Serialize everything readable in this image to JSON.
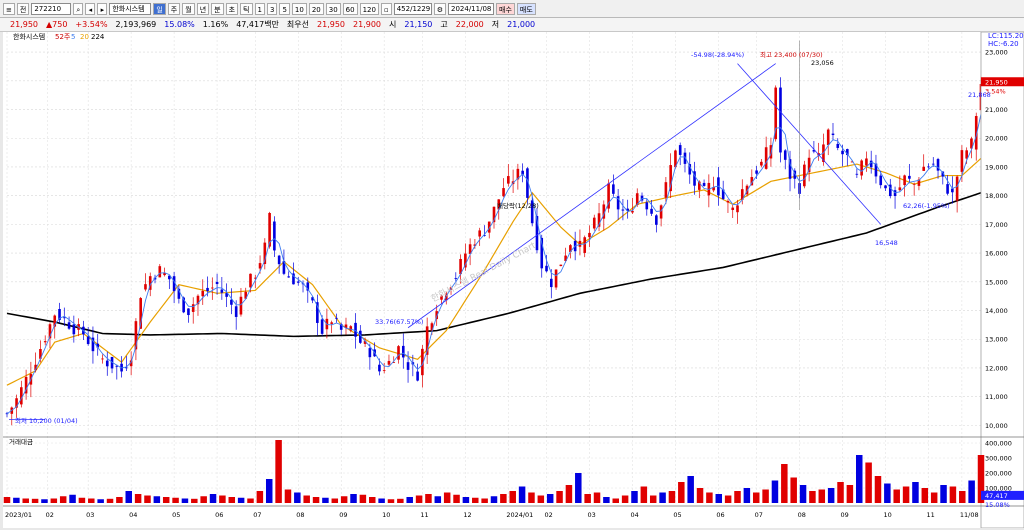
{
  "toolbar": {
    "menu_icon": "menu-icon",
    "market_label": "전",
    "code": "272210",
    "stock_name": "한화시스템",
    "periods": [
      "주",
      "월",
      "년",
      "분",
      "초",
      "틱"
    ],
    "intervals": [
      "1",
      "3",
      "5",
      "10",
      "20",
      "30",
      "60",
      "120"
    ],
    "page_counter": "452/1229",
    "date": "2024/11/08",
    "buy_label": "매수",
    "sell_label": "매도"
  },
  "quote": {
    "price": "21,950",
    "change": "▲750",
    "change_pct": "+3.54%",
    "volume": "2,193,969",
    "turnover_pct": "15.08%",
    "ratio": "1.16%",
    "amount": "47,417백만",
    "extra_label": "최우선",
    "bid": "21,950",
    "ask": "21,900",
    "open_label": "시",
    "open": "21,150",
    "high_label": "고",
    "high": "22,000",
    "low_label": "저",
    "low": "21,000"
  },
  "legend": {
    "name": "한화시스템",
    "ma_label": "52주",
    "ma5": "5",
    "ma20": "20",
    "ma224": "224"
  },
  "volume_legend": "거래대금",
  "annotations": {
    "lc": "LC:115.20",
    "hc": "HC:-6.20",
    "high_note": "최고 23,400 (07/30)",
    "low_note": "최저 10,200 (01/04)",
    "trend_note_down": "-54.98(-28.94%)",
    "trend_note_up": "33.76(67.57%)",
    "peak_label": "23,056",
    "trough_label": "16,548",
    "right_label": "21,868",
    "dividend_label": "배당락(12/28)",
    "vol_ma_label": "62,26(-1.95%)",
    "watermark": "한화시스템  Real Daily Chart"
  },
  "colors": {
    "up": "#e00000",
    "down": "#0000e0",
    "ma5": "#3d7df0",
    "ma20": "#e8a000",
    "ma224": "#000000",
    "trend": "#3030ff"
  },
  "chart_data": {
    "type": "candlestick",
    "price_axis": [
      "23,000",
      "22,000",
      "21,000",
      "20,000",
      "19,000",
      "18,000",
      "17,000",
      "16,000",
      "15,000",
      "14,000",
      "13,000",
      "12,000",
      "11,000",
      "10,000"
    ],
    "price_range": [
      9700,
      23700
    ],
    "current_price": "21,950",
    "current_pct": "3.54%",
    "volume_axis": [
      "400,000",
      "300,000",
      "200,000",
      "100,000"
    ],
    "volume_range": [
      0,
      420000
    ],
    "current_volume": "47,417",
    "current_volume_pct": "15.08%",
    "x_ticks": [
      "2023/01",
      "02",
      "03",
      "04",
      "05",
      "06",
      "07",
      "08",
      "09",
      "10",
      "11",
      "12",
      "2024/01",
      "02",
      "03",
      "04",
      "05",
      "06",
      "07",
      "08",
      "09",
      "10",
      "11",
      "11/08"
    ],
    "close_path": [
      [
        0,
        10400
      ],
      [
        2,
        10900
      ],
      [
        4,
        11600
      ],
      [
        6,
        12300
      ],
      [
        8,
        13100
      ],
      [
        10,
        13900
      ],
      [
        12,
        13700
      ],
      [
        14,
        13400
      ],
      [
        16,
        13200
      ],
      [
        18,
        12700
      ],
      [
        20,
        12300
      ],
      [
        22,
        12100
      ],
      [
        24,
        11900
      ],
      [
        26,
        12500
      ],
      [
        28,
        14600
      ],
      [
        30,
        15200
      ],
      [
        32,
        15400
      ],
      [
        34,
        15100
      ],
      [
        36,
        14300
      ],
      [
        38,
        14000
      ],
      [
        40,
        14500
      ],
      [
        42,
        14700
      ],
      [
        44,
        14900
      ],
      [
        46,
        14400
      ],
      [
        48,
        14000
      ],
      [
        50,
        14800
      ],
      [
        52,
        15300
      ],
      [
        54,
        16200
      ],
      [
        55,
        17200
      ],
      [
        56,
        16100
      ],
      [
        58,
        15300
      ],
      [
        60,
        15100
      ],
      [
        62,
        14800
      ],
      [
        64,
        14200
      ],
      [
        66,
        13300
      ],
      [
        68,
        13700
      ],
      [
        70,
        13300
      ],
      [
        72,
        13400
      ],
      [
        74,
        12900
      ],
      [
        76,
        12600
      ],
      [
        78,
        11900
      ],
      [
        80,
        12200
      ],
      [
        82,
        12700
      ],
      [
        84,
        12100
      ],
      [
        86,
        11800
      ],
      [
        88,
        13400
      ],
      [
        90,
        14200
      ],
      [
        92,
        14800
      ],
      [
        94,
        15200
      ],
      [
        96,
        16000
      ],
      [
        98,
        16500
      ],
      [
        100,
        16800
      ],
      [
        102,
        17500
      ],
      [
        104,
        18300
      ],
      [
        106,
        18600
      ],
      [
        108,
        18900
      ],
      [
        110,
        17100
      ],
      [
        112,
        15600
      ],
      [
        114,
        15000
      ],
      [
        116,
        15700
      ],
      [
        118,
        16400
      ],
      [
        120,
        16200
      ],
      [
        122,
        16700
      ],
      [
        124,
        17300
      ],
      [
        126,
        18200
      ],
      [
        128,
        17600
      ],
      [
        130,
        17300
      ],
      [
        132,
        18100
      ],
      [
        134,
        17700
      ],
      [
        136,
        17200
      ],
      [
        138,
        18300
      ],
      [
        140,
        19700
      ],
      [
        142,
        19000
      ],
      [
        144,
        18400
      ],
      [
        146,
        18100
      ],
      [
        148,
        18500
      ],
      [
        150,
        17900
      ],
      [
        152,
        17500
      ],
      [
        154,
        18200
      ],
      [
        156,
        18700
      ],
      [
        158,
        19100
      ],
      [
        160,
        19800
      ],
      [
        161,
        21800
      ],
      [
        162,
        19500
      ],
      [
        164,
        18700
      ],
      [
        166,
        18300
      ],
      [
        168,
        19500
      ],
      [
        170,
        19300
      ],
      [
        172,
        20200
      ],
      [
        174,
        19600
      ],
      [
        176,
        19300
      ],
      [
        178,
        18600
      ],
      [
        180,
        19400
      ],
      [
        182,
        18800
      ],
      [
        184,
        18200
      ],
      [
        186,
        18000
      ],
      [
        188,
        18600
      ],
      [
        190,
        18400
      ],
      [
        192,
        19000
      ],
      [
        194,
        19100
      ],
      [
        196,
        18500
      ],
      [
        198,
        18000
      ],
      [
        200,
        19400
      ],
      [
        202,
        19800
      ],
      [
        204,
        21900
      ]
    ],
    "ma20_path": [
      [
        0,
        11400
      ],
      [
        6,
        11900
      ],
      [
        10,
        12900
      ],
      [
        16,
        13200
      ],
      [
        24,
        12200
      ],
      [
        30,
        13600
      ],
      [
        36,
        14900
      ],
      [
        44,
        14600
      ],
      [
        52,
        14700
      ],
      [
        58,
        15700
      ],
      [
        64,
        14900
      ],
      [
        70,
        13500
      ],
      [
        78,
        12700
      ],
      [
        86,
        12300
      ],
      [
        92,
        13300
      ],
      [
        100,
        15400
      ],
      [
        106,
        17100
      ],
      [
        110,
        18100
      ],
      [
        116,
        16900
      ],
      [
        120,
        16300
      ],
      [
        126,
        16900
      ],
      [
        132,
        17700
      ],
      [
        140,
        18000
      ],
      [
        146,
        18200
      ],
      [
        152,
        17700
      ],
      [
        156,
        18100
      ],
      [
        160,
        18500
      ],
      [
        166,
        18700
      ],
      [
        172,
        18900
      ],
      [
        178,
        19100
      ],
      [
        184,
        18800
      ],
      [
        190,
        18400
      ],
      [
        196,
        18700
      ],
      [
        200,
        18700
      ],
      [
        204,
        19300
      ]
    ],
    "ma224_path": [
      [
        0,
        13900
      ],
      [
        10,
        13600
      ],
      [
        20,
        13200
      ],
      [
        30,
        13150
      ],
      [
        45,
        13200
      ],
      [
        60,
        13100
      ],
      [
        75,
        13150
      ],
      [
        90,
        13300
      ],
      [
        105,
        13900
      ],
      [
        120,
        14600
      ],
      [
        135,
        15100
      ],
      [
        150,
        15500
      ],
      [
        165,
        16100
      ],
      [
        180,
        16700
      ],
      [
        195,
        17600
      ],
      [
        204,
        18100
      ]
    ],
    "volume_bars": [
      40,
      35,
      30,
      28,
      25,
      30,
      45,
      55,
      35,
      30,
      25,
      28,
      40,
      80,
      60,
      50,
      45,
      40,
      35,
      30,
      28,
      45,
      60,
      50,
      40,
      35,
      30,
      80,
      160,
      420,
      90,
      70,
      50,
      40,
      35,
      30,
      45,
      60,
      55,
      40,
      30,
      25,
      28,
      40,
      50,
      60,
      45,
      70,
      55,
      40,
      35,
      30,
      45,
      60,
      80,
      110,
      70,
      50,
      60,
      80,
      120,
      200,
      60,
      70,
      40,
      30,
      50,
      80,
      110,
      50,
      70,
      80,
      140,
      180,
      100,
      70,
      60,
      50,
      80,
      100,
      70,
      90,
      150,
      260,
      170,
      120,
      80,
      90,
      100,
      140,
      120,
      320,
      270,
      180,
      130,
      90,
      110,
      140,
      100,
      70,
      120,
      110,
      80,
      150,
      320
    ]
  }
}
